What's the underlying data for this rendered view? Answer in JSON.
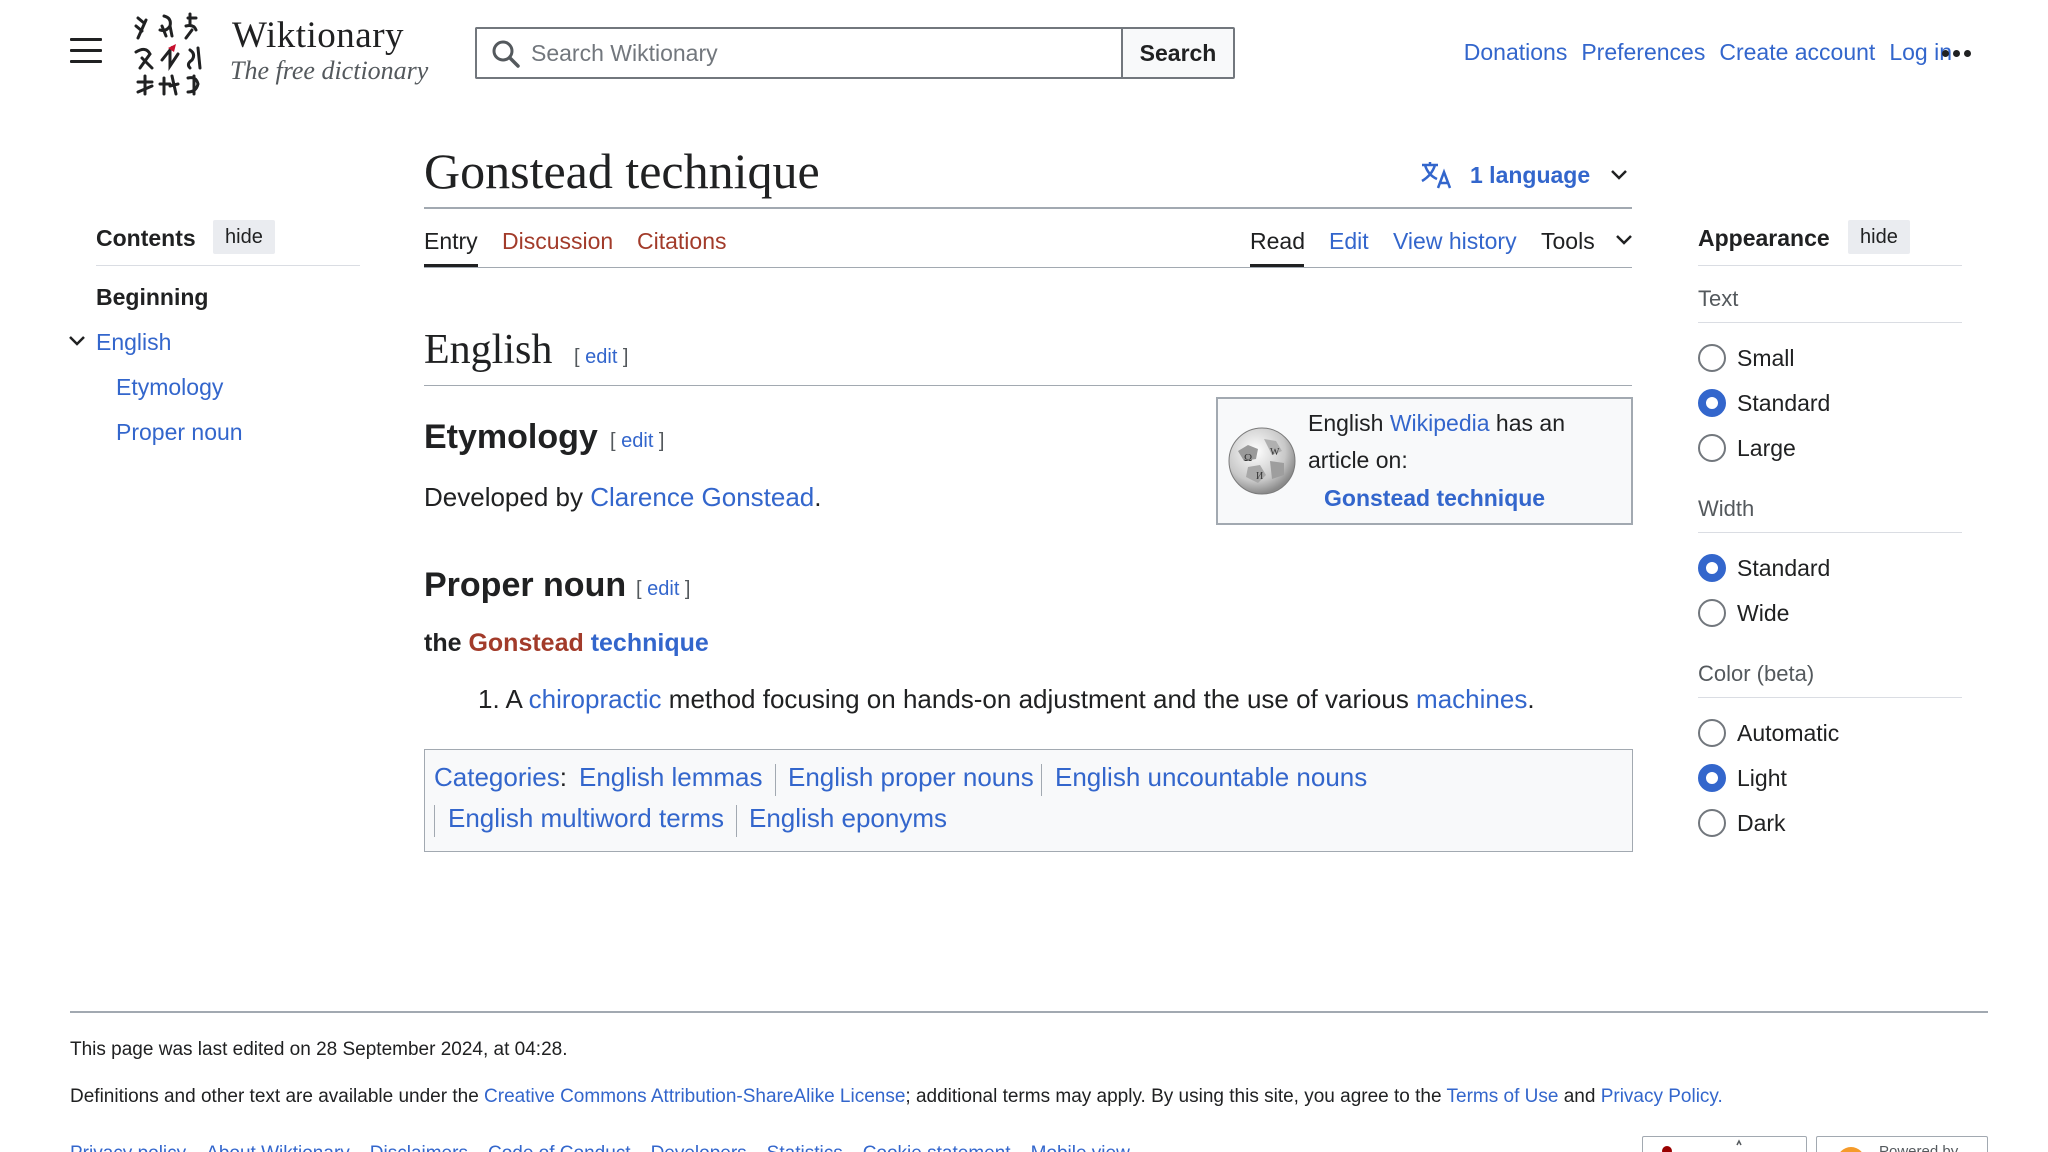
{
  "header": {
    "logo_title": "Wiktionary",
    "logo_subtitle": "The free dictionary",
    "search_placeholder": "Search Wiktionary",
    "search_button": "Search",
    "user_links": [
      "Donations",
      "Preferences",
      "Create account",
      "Log in"
    ]
  },
  "page": {
    "title": "Gonstead technique",
    "languages": "1 language",
    "tabs_left": [
      "Entry",
      "Discussion",
      "Citations"
    ],
    "tabs_right": [
      "Read",
      "Edit",
      "View history",
      "Tools"
    ]
  },
  "toc": {
    "title": "Contents",
    "hide": "hide",
    "items": [
      "Beginning",
      "English",
      "Etymology",
      "Proper noun"
    ]
  },
  "content": {
    "lang_heading": "English",
    "edit_label": "edit",
    "etymology_heading": "Etymology",
    "etymology_prefix": "Developed by ",
    "etymology_link": "Clarence Gonstead",
    "etymology_suffix": ".",
    "pos_heading": "Proper noun",
    "headword_prefix": "the ",
    "headword_red": "Gonstead",
    "headword_blue": "technique",
    "definition_number": "1.",
    "definition_a": "A ",
    "definition_link1": "chiropractic",
    "definition_mid": " method focusing on hands-on adjustment and the use of various ",
    "definition_link2": "machines",
    "definition_end": ".",
    "wikipedia_box": {
      "line1_prefix": "English ",
      "line1_link": "Wikipedia",
      "line1_suffix": " has an",
      "line2": "article on:",
      "article": "Gonstead technique"
    },
    "categories_label": "Categories",
    "categories_colon": ":",
    "categories": [
      "English lemmas",
      "English proper nouns",
      "English uncountable nouns",
      "English multiword terms",
      "English eponyms"
    ]
  },
  "appearance": {
    "title": "Appearance",
    "hide": "hide",
    "text_label": "Text",
    "text_options": [
      "Small",
      "Standard",
      "Large"
    ],
    "text_selected": "Standard",
    "width_label": "Width",
    "width_options": [
      "Standard",
      "Wide"
    ],
    "width_selected": "Standard",
    "color_label": "Color (beta)",
    "color_options": [
      "Automatic",
      "Light",
      "Dark"
    ],
    "color_selected": "Light"
  },
  "footer": {
    "last_edited": "This page was last edited on 28 September 2024, at 04:28.",
    "license_prefix": "Definitions and other text are available under the ",
    "license_link": "Creative Commons Attribution-ShareAlike License",
    "license_mid": "; additional terms may apply. By using this site, you agree to the ",
    "terms_link": "Terms of Use",
    "license_and": " and ",
    "privacy_link": "Privacy Policy.",
    "links": [
      "Privacy policy",
      "About Wiktionary",
      "Disclaimers",
      "Code of Conduct",
      "Developers",
      "Statistics",
      "Cookie statement",
      "Mobile view"
    ],
    "badge_powered": "Powered by"
  },
  "colors": {
    "link": "#3366cc",
    "redlink": "#a23b2a",
    "text": "#202122",
    "border": "#a2a9b1"
  }
}
